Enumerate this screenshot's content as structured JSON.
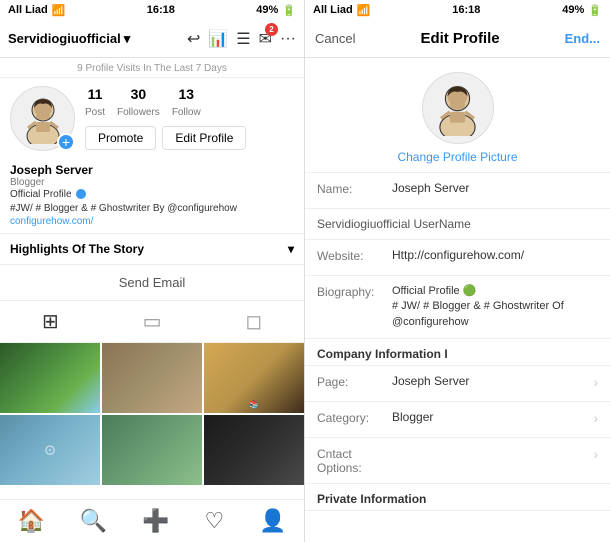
{
  "left": {
    "status": {
      "carrier": "All Liad",
      "time": "16:18",
      "battery": "49%"
    },
    "nav": {
      "brand": "Servidiogiuofficial",
      "icons": [
        "↩",
        "📊",
        "☰",
        "✉",
        "···"
      ]
    },
    "profile_visits": "9 Profile Visits In The Last 7 Days",
    "stats": [
      {
        "num": "11",
        "label": "Post"
      },
      {
        "num": "30",
        "label": "Followers"
      },
      {
        "num": "13",
        "label": "Follow"
      }
    ],
    "buttons": {
      "promote": "Promote",
      "edit": "Edit Profile"
    },
    "bio": {
      "name": "Joseph Server",
      "tag": "Blogger",
      "description": "Official Profile",
      "hashtags": "#JW/ # Blogger & # Ghostwriter By @configurehow",
      "link": "configurehow.com/"
    },
    "highlights": "Highlights Of The Story",
    "send_email": "Send Email",
    "tabs": [
      "grid",
      "tablet",
      "person"
    ],
    "bottom_nav": [
      "🏠",
      "🔍",
      "➕",
      "♡",
      "👤"
    ]
  },
  "right": {
    "status": {
      "carrier": "All Liad",
      "time": "16:18",
      "battery": "49%"
    },
    "nav": {
      "cancel": "Cancel",
      "title": "Edit Profile",
      "done": "End..."
    },
    "avatar": {
      "change_text": "Change Profile Picture"
    },
    "fields": [
      {
        "label": "Name:",
        "value": "Joseph Server"
      },
      {
        "label": "Username:",
        "value": "Servidiogiuofficial UserName",
        "is_username": true
      },
      {
        "label": "Website:",
        "value": "Http://configurehow.com/"
      },
      {
        "label": "Biography:",
        "value": "Official Profile 🟢\n# JW/ # Blogger & # Ghostwriter Of\n@configurehow",
        "multiline": true
      }
    ],
    "sections": [
      {
        "header": "Company Information I",
        "items": [
          {
            "label": "Page:",
            "value": "Joseph Server",
            "has_arrow": true
          },
          {
            "label": "Category:",
            "value": "Blogger",
            "has_arrow": true
          },
          {
            "label": "Cntact Options:",
            "value": "",
            "has_arrow": true
          },
          {
            "label": "Private Information",
            "value": "",
            "is_header": true
          }
        ]
      }
    ]
  }
}
